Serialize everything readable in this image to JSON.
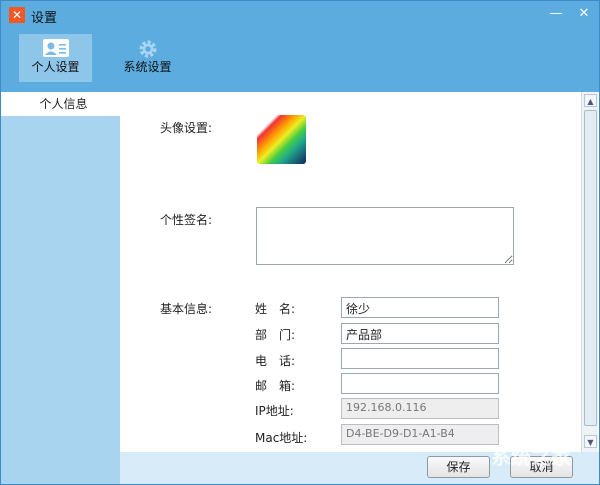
{
  "window": {
    "title": "设置"
  },
  "toolbar": {
    "items": [
      {
        "label": "个人设置",
        "icon": "contact-card-icon",
        "active": true
      },
      {
        "label": "系统设置",
        "icon": "gear-icon",
        "active": false
      }
    ]
  },
  "sidebar": {
    "items": [
      {
        "label": "个人信息",
        "selected": true
      }
    ]
  },
  "form": {
    "avatar_label": "头像设置:",
    "signature_label": "个性签名:",
    "signature_value": "",
    "basic_label": "基本信息:",
    "fields": [
      {
        "label": "姓　名:",
        "value": "徐少",
        "readonly": false
      },
      {
        "label": "部　门:",
        "value": "产品部",
        "readonly": false
      },
      {
        "label": "电　话:",
        "value": "",
        "readonly": false
      },
      {
        "label": "邮　箱:",
        "value": "",
        "readonly": false
      },
      {
        "label": "IP地址:",
        "value": "192.168.0.116",
        "readonly": true
      },
      {
        "label": "Mac地址:",
        "value": "D4-BE-D9-D1-A1-B4",
        "readonly": true
      }
    ]
  },
  "buttons": {
    "save": "保存",
    "cancel": "取消"
  },
  "watermark": "系统之家"
}
